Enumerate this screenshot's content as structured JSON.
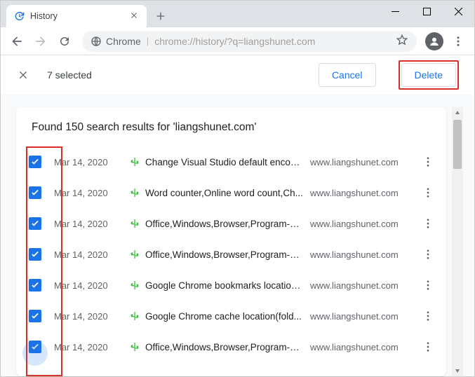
{
  "window": {
    "tab_title": "History",
    "newtab_label": "+"
  },
  "omnibox": {
    "prefix_app": "Chrome",
    "url": "chrome://history/?q=liangshunet.com"
  },
  "selection": {
    "count_text": "7 selected",
    "cancel_label": "Cancel",
    "delete_label": "Delete"
  },
  "results": {
    "header": "Found 150 search results for 'liangshunet.com'",
    "rows": [
      {
        "date": "Mar 14, 2020",
        "title": "Change Visual Studio default encod...",
        "domain": "www.liangshunet.com",
        "checked": true
      },
      {
        "date": "Mar 14, 2020",
        "title": "Word counter,Online word count,Ch...",
        "domain": "www.liangshunet.com",
        "checked": true
      },
      {
        "date": "Mar 14, 2020",
        "title": "Office,Windows,Browser,Program-Li...",
        "domain": "www.liangshunet.com",
        "checked": true
      },
      {
        "date": "Mar 14, 2020",
        "title": "Office,Windows,Browser,Program-Li...",
        "domain": "www.liangshunet.com",
        "checked": true
      },
      {
        "date": "Mar 14, 2020",
        "title": "Google Chrome bookmarks location...",
        "domain": "www.liangshunet.com",
        "checked": true
      },
      {
        "date": "Mar 14, 2020",
        "title": "Google Chrome cache location(fold...",
        "domain": "www.liangshunet.com",
        "checked": true
      },
      {
        "date": "Mar 14, 2020",
        "title": "Office,Windows,Browser,Program-Li...",
        "domain": "www.liangshunet.com",
        "checked": true,
        "ripple": true
      }
    ]
  }
}
